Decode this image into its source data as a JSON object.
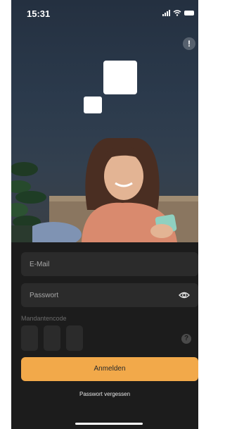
{
  "status_bar": {
    "time": "15:31"
  },
  "hero": {
    "info_button": "!"
  },
  "form": {
    "email": {
      "placeholder": "E-Mail"
    },
    "password": {
      "placeholder": "Passwort"
    },
    "client_code": {
      "label": "Mandantencode",
      "help_icon": "?"
    },
    "login_button": "Anmelden",
    "forgot_password": "Passwort vergessen"
  },
  "colors": {
    "accent": "#f2a94a",
    "background": "#1c1c1c",
    "field": "#2b2b2b"
  },
  "icons": [
    "wifi-icon",
    "signal-icon",
    "battery-icon",
    "info-icon",
    "eye-icon",
    "help-icon"
  ]
}
